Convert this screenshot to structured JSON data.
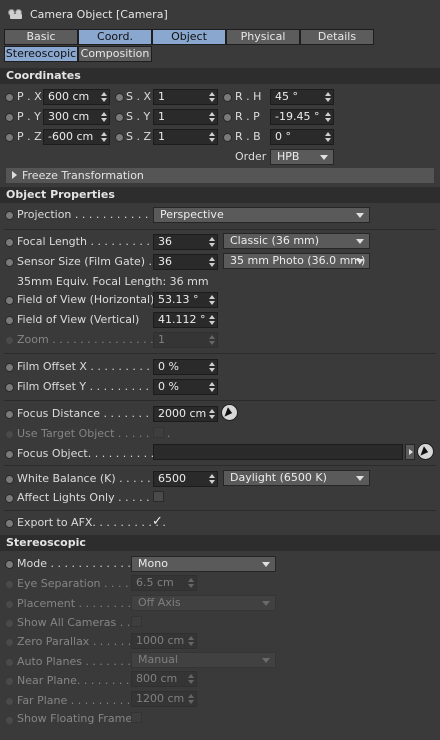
{
  "window": {
    "title": "Camera Object [Camera]",
    "icon": "camera-icon"
  },
  "tabs_row1": [
    "Basic",
    "Coord.",
    "Object",
    "Physical",
    "Details"
  ],
  "tabs_row2": [
    "Stereoscopic",
    "Composition"
  ],
  "active_tabs": [
    "Coord.",
    "Object",
    "Stereoscopic"
  ],
  "coordinates": {
    "section": "Coordinates",
    "px": {
      "label": "P . X",
      "value": "600 cm"
    },
    "py": {
      "label": "P . Y",
      "value": "300 cm"
    },
    "pz": {
      "label": "P . Z",
      "value": "-600 cm"
    },
    "sx": {
      "label": "S . X",
      "value": "1"
    },
    "sy": {
      "label": "S . Y",
      "value": "1"
    },
    "sz": {
      "label": "S . Z",
      "value": "1"
    },
    "rh": {
      "label": "R . H",
      "value": "45 °"
    },
    "rp": {
      "label": "R . P",
      "value": "-19.45 °"
    },
    "rb": {
      "label": "R . B",
      "value": "0 °"
    },
    "order_label": "Order",
    "order_value": "HPB",
    "freeze": "Freeze Transformation"
  },
  "object_properties": {
    "section": "Object Properties",
    "projection": {
      "label": "Projection . . . . . . . . . . . . .",
      "value": "Perspective"
    },
    "focal_length": {
      "label": "Focal Length . . . . . . . . . . .",
      "value": "36",
      "preset": "Classic (36 mm)"
    },
    "sensor_size": {
      "label": "Sensor Size (Film Gate) . . .",
      "value": "36",
      "preset": "35 mm Photo (36.0 mm)"
    },
    "equiv": "35mm Equiv. Focal Length: 36 mm",
    "fov_h": {
      "label": "Field of View (Horizontal)",
      "value": "53.13 °"
    },
    "fov_v": {
      "label": "Field of View (Vertical)",
      "value": "41.112 °"
    },
    "zoom": {
      "label": "Zoom . . . . . . . . . . . . . . . . .",
      "value": "1"
    },
    "film_offset_x": {
      "label": "Film Offset X . . . . . . . . . . .",
      "value": "0 %"
    },
    "film_offset_y": {
      "label": "Film Offset Y . . . . . . . . . . .",
      "value": "0 %"
    },
    "focus_distance": {
      "label": "Focus Distance . . . . . . . . .",
      "value": "2000 cm"
    },
    "use_target": {
      "label": "Use Target Object . . . . . . . ."
    },
    "focus_object": {
      "label": "Focus Object. . . . . . . . . . . ."
    },
    "white_balance": {
      "label": "White Balance (K) . . . . . . .",
      "value": "6500",
      "preset": "Daylight (6500 K)"
    },
    "affect_lights": {
      "label": "Affect Lights Only . . . . . . ."
    },
    "export_afx": {
      "label": "Export to AFX. . . . . . . . . . .",
      "checked": "✓"
    }
  },
  "stereoscopic": {
    "section": "Stereoscopic",
    "mode": {
      "label": "Mode . . . . . . . . . . . .",
      "value": "Mono"
    },
    "eye_sep": {
      "label": "Eye Separation . . . .",
      "value": "6.5 cm"
    },
    "placement": {
      "label": "Placement . . . . . . . . .",
      "value": "Off Axis"
    },
    "show_all": {
      "label": "Show All Cameras . . ."
    },
    "zero_parallax": {
      "label": "Zero Parallax . . . . . .",
      "value": "1000 cm"
    },
    "auto_planes": {
      "label": "Auto Planes . . . . . . .",
      "value": "Manual"
    },
    "near_plane": {
      "label": "Near Plane. . . . . . . . .",
      "value": "800 cm"
    },
    "far_plane": {
      "label": "Far Plane . . . . . . . . .",
      "value": "1200 cm"
    },
    "floating_frame": {
      "label": "Show Floating Frame"
    }
  }
}
